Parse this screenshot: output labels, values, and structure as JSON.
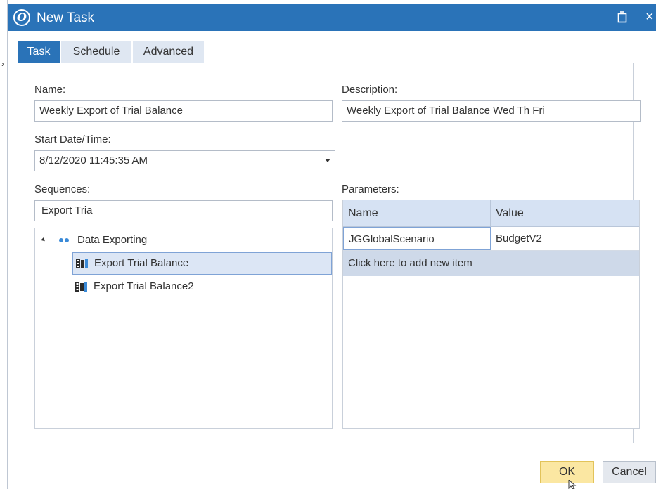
{
  "window": {
    "title": "New Task"
  },
  "tabs": [
    {
      "label": "Task",
      "active": true
    },
    {
      "label": "Schedule",
      "active": false
    },
    {
      "label": "Advanced",
      "active": false
    }
  ],
  "form": {
    "name_label": "Name:",
    "name_value": "Weekly Export of Trial Balance",
    "description_label": "Description:",
    "description_value": "Weekly Export of Trial Balance Wed Th Fri",
    "start_label": "Start Date/Time:",
    "start_value": "8/12/2020 11:45:35 AM"
  },
  "sequences": {
    "label": "Sequences:",
    "search_value": "Export Tria",
    "tree": {
      "group": "Data Exporting",
      "items": [
        "Export Trial Balance",
        "Export Trial Balance2"
      ],
      "selected": "Export Trial Balance"
    }
  },
  "parameters": {
    "label": "Parameters:",
    "columns": [
      "Name",
      "Value"
    ],
    "rows": [
      {
        "name": "JGGlobalScenario",
        "value": "BudgetV2"
      }
    ],
    "add_row_text": "Click here to add new item"
  },
  "buttons": {
    "ok": "OK",
    "cancel": "Cancel"
  },
  "colors": {
    "accent": "#2a73b8",
    "ok_button": "#fbe7a2",
    "selection": "#dce6f5"
  },
  "icons": [
    "app-logo-icon",
    "restore-icon",
    "close-icon",
    "dropdown-arrow-icon",
    "group-dots-icon",
    "sequence-icon",
    "mouse-cursor-icon"
  ]
}
